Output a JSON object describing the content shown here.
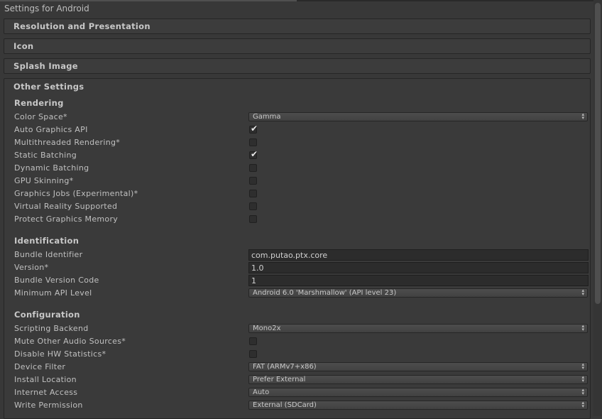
{
  "window": {
    "title": "Settings for Android"
  },
  "foldouts": [
    {
      "label": "Resolution and Presentation"
    },
    {
      "label": "Icon"
    },
    {
      "label": "Splash Image"
    },
    {
      "label": "Other Settings"
    }
  ],
  "rendering": {
    "title": "Rendering",
    "rows": [
      {
        "label": "Color Space*",
        "type": "dropdown",
        "value": "Gamma"
      },
      {
        "label": "Auto Graphics API",
        "type": "checkbox",
        "checked": true
      },
      {
        "label": "Multithreaded Rendering*",
        "type": "checkbox",
        "checked": false
      },
      {
        "label": "Static Batching",
        "type": "checkbox",
        "checked": true
      },
      {
        "label": "Dynamic Batching",
        "type": "checkbox",
        "checked": false
      },
      {
        "label": "GPU Skinning*",
        "type": "checkbox",
        "checked": false
      },
      {
        "label": "Graphics Jobs (Experimental)*",
        "type": "checkbox",
        "checked": false
      },
      {
        "label": "Virtual Reality Supported",
        "type": "checkbox",
        "checked": false
      },
      {
        "label": "Protect Graphics Memory",
        "type": "checkbox",
        "checked": false
      }
    ]
  },
  "identification": {
    "title": "Identification",
    "rows": [
      {
        "label": "Bundle Identifier",
        "type": "text",
        "value": "com.putao.ptx.core"
      },
      {
        "label": "Version*",
        "type": "text",
        "value": "1.0"
      },
      {
        "label": "Bundle Version Code",
        "type": "text",
        "value": "1"
      },
      {
        "label": "Minimum API Level",
        "type": "dropdown",
        "value": "Android 6.0 'Marshmallow' (API level 23)"
      }
    ]
  },
  "configuration": {
    "title": "Configuration",
    "rows": [
      {
        "label": "Scripting Backend",
        "type": "dropdown",
        "value": "Mono2x"
      },
      {
        "label": "Mute Other Audio Sources*",
        "type": "checkbox",
        "checked": false
      },
      {
        "label": "Disable HW Statistics*",
        "type": "checkbox",
        "checked": false
      },
      {
        "label": "Device Filter",
        "type": "dropdown",
        "value": "FAT (ARMv7+x86)"
      },
      {
        "label": "Install Location",
        "type": "dropdown",
        "value": "Prefer External"
      },
      {
        "label": "Internet Access",
        "type": "dropdown",
        "value": "Auto"
      },
      {
        "label": "Write Permission",
        "type": "dropdown",
        "value": "External (SDCard)"
      }
    ]
  },
  "icons": {
    "check": "checkmark-icon",
    "dropdown_arrows": "updown-arrows-icon"
  },
  "colors": {
    "background": "#383838",
    "panel": "#3a3a3a",
    "field": "#2c2c2c",
    "text": "#c2c2c2"
  }
}
